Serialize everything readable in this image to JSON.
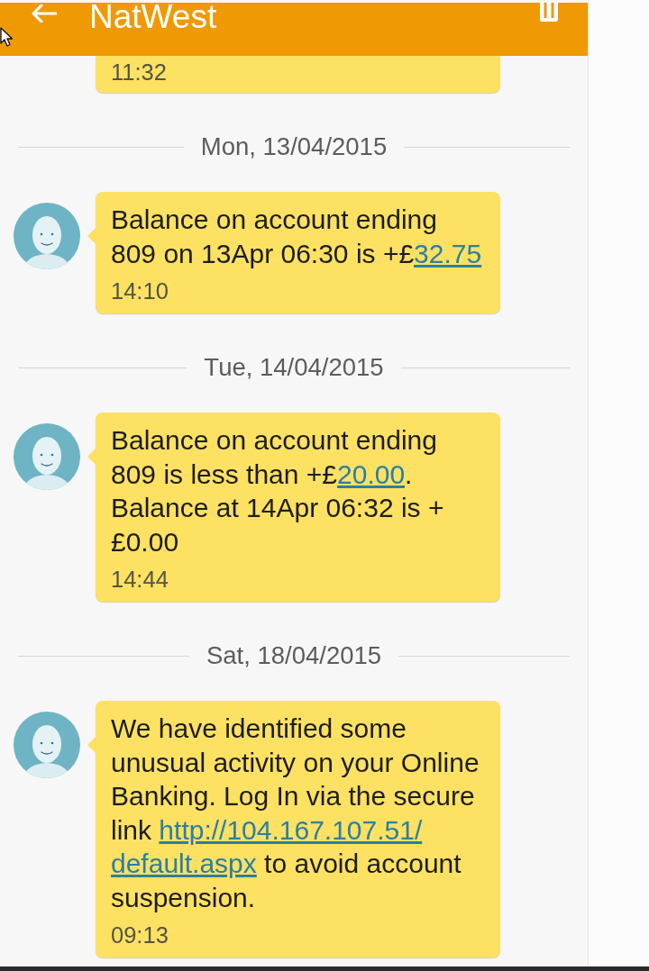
{
  "header": {
    "title": "NatWest"
  },
  "conversation": [
    {
      "kind": "cut-message",
      "time": "11:32"
    },
    {
      "kind": "date",
      "text": "Mon, 13/04/2015"
    },
    {
      "kind": "message",
      "parts": [
        {
          "kind": "text",
          "text": "Balance on account ending 809 on 13Apr 06:30 is +£"
        },
        {
          "kind": "link",
          "text": "32.75"
        }
      ],
      "time": "14:10"
    },
    {
      "kind": "date",
      "text": "Tue, 14/04/2015"
    },
    {
      "kind": "message",
      "parts": [
        {
          "kind": "text",
          "text": "Balance on account ending 809 is less than +£"
        },
        {
          "kind": "link",
          "text": "20.00"
        },
        {
          "kind": "text",
          "text": ". Balance at 14Apr 06:32 is +£0.00"
        }
      ],
      "time": "14:44"
    },
    {
      "kind": "date",
      "text": "Sat, 18/04/2015"
    },
    {
      "kind": "message",
      "parts": [
        {
          "kind": "text",
          "text": "We have identified some unusual activity on your Online Banking. Log In via the secure link "
        },
        {
          "kind": "link",
          "text": "http://104.167.107.51/"
        },
        {
          "kind": "link",
          "text": "default.aspx"
        },
        {
          "kind": "text",
          "text": " to avoid account suspension."
        }
      ],
      "time": "09:13"
    }
  ]
}
